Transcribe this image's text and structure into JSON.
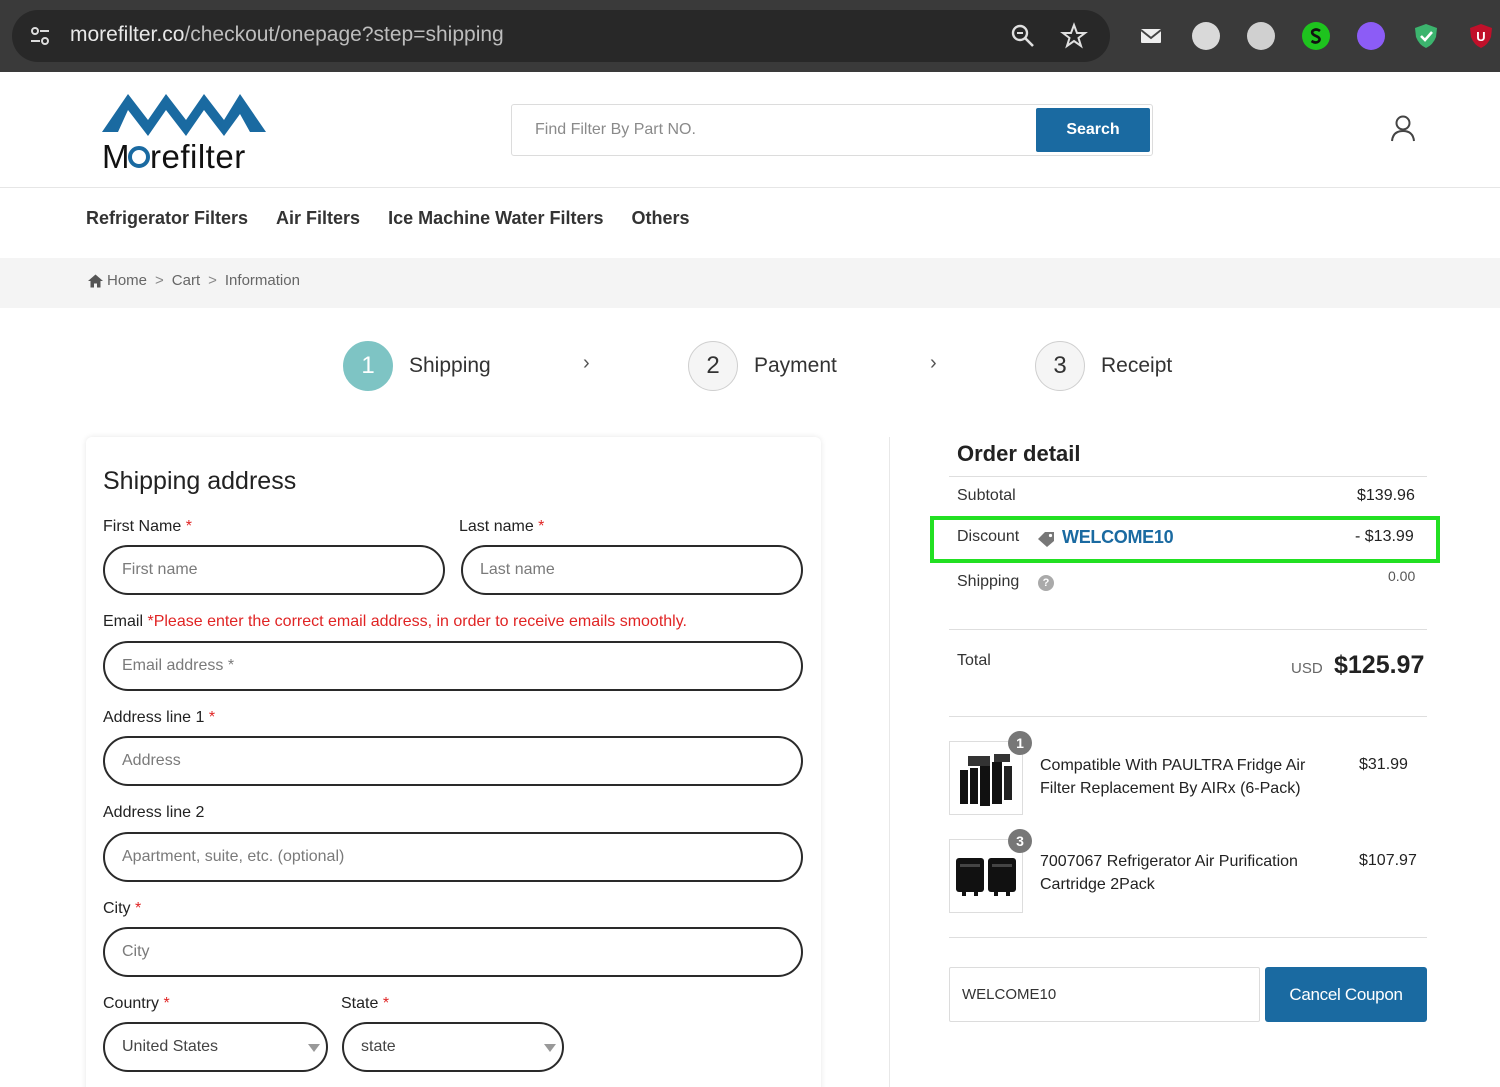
{
  "browser": {
    "url_host": "morefilter.co",
    "url_path": "/checkout/onepage?step=shipping"
  },
  "header": {
    "search_placeholder": "Find Filter By Part NO.",
    "search_button": "Search"
  },
  "nav": [
    "Refrigerator Filters",
    "Air Filters",
    "Ice Machine Water Filters",
    "Others"
  ],
  "breadcrumb": [
    "Home",
    "Cart",
    "Information"
  ],
  "steps": [
    {
      "num": "1",
      "label": "Shipping"
    },
    {
      "num": "2",
      "label": "Payment"
    },
    {
      "num": "3",
      "label": "Receipt"
    }
  ],
  "shipping": {
    "title": "Shipping address",
    "first_name_label": "First Name",
    "first_name_placeholder": "First name",
    "last_name_label": "Last name",
    "last_name_placeholder": "Last name",
    "email_label": "Email",
    "email_note": "*Please enter the correct email address, in order to receive emails smoothly.",
    "email_placeholder": "Email address *",
    "address1_label": "Address line 1",
    "address1_placeholder": "Address",
    "address2_label": "Address line 2",
    "address2_placeholder": "Apartment, suite, etc. (optional)",
    "city_label": "City",
    "city_placeholder": "City",
    "country_label": "Country",
    "country_value": "United States",
    "state_label": "State",
    "state_value": "state",
    "required_mark": "*"
  },
  "order": {
    "title": "Order detail",
    "subtotal_label": "Subtotal",
    "subtotal_value": "$139.96",
    "discount_label": "Discount",
    "discount_code": "WELCOME10",
    "discount_value": "- $13.99",
    "shipping_label": "Shipping",
    "shipping_value": "0.00",
    "total_label": "Total",
    "currency": "USD",
    "total_value": "$125.97",
    "items": [
      {
        "qty": "1",
        "name": "Compatible With PAULTRA Fridge Air Filter Replacement By AIRx (6-Pack)",
        "price": "$31.99"
      },
      {
        "qty": "3",
        "name": "7007067 Refrigerator Air Purification Cartridge 2Pack",
        "price": "$107.97"
      }
    ],
    "coupon_value": "WELCOME10",
    "cancel_coupon": "Cancel Coupon"
  },
  "colors": {
    "brand_blue": "#1a6aa1",
    "active_step": "#7ec4c4",
    "highlight": "#22e022",
    "required": "#e02424"
  }
}
